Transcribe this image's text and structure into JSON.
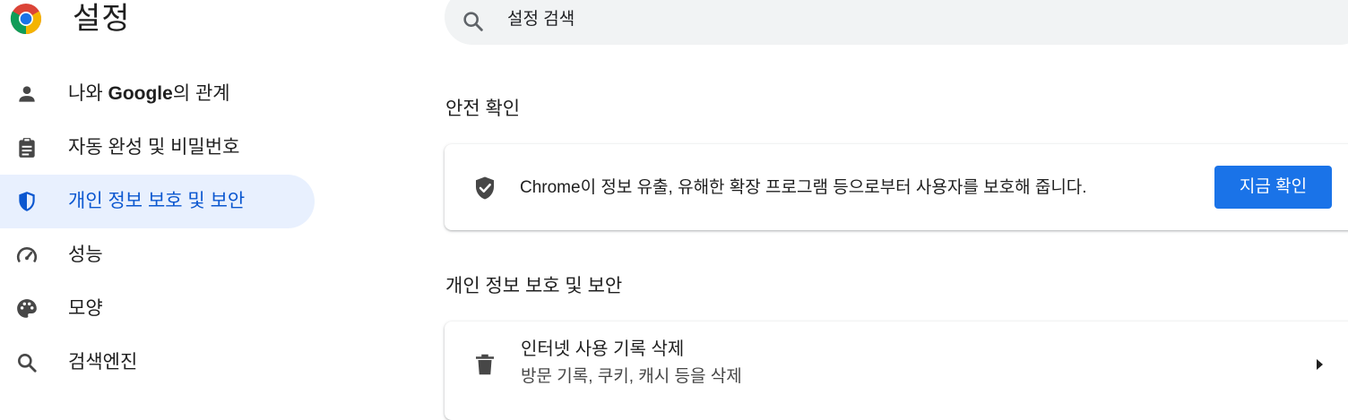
{
  "header": {
    "title": "설정",
    "search_placeholder": "설정 검색"
  },
  "sidebar": {
    "items": [
      {
        "label_prefix": "나와 ",
        "label_brand": "Google",
        "label_suffix": "의 관계",
        "icon": "person-icon"
      },
      {
        "label": "자동 완성 및 비밀번호",
        "icon": "clipboard-icon"
      },
      {
        "label": "개인 정보 보호 및 보안",
        "icon": "shield-icon",
        "active": true
      },
      {
        "label": "성능",
        "icon": "speedometer-icon"
      },
      {
        "label": "모양",
        "icon": "palette-icon"
      },
      {
        "label": "검색엔진",
        "icon": "search-icon"
      }
    ]
  },
  "main": {
    "safety_check": {
      "title": "안전 확인",
      "text": "Chrome이 정보 유출, 유해한 확장 프로그램 등으로부터 사용자를 보호해 줍니다.",
      "button": "지금 확인"
    },
    "privacy": {
      "title": "개인 정보 보호 및 보안",
      "rows": [
        {
          "title": "인터넷 사용 기록 삭제",
          "subtitle": "방문 기록, 쿠키, 캐시 등을 삭제",
          "icon": "trash-icon"
        }
      ]
    }
  },
  "colors": {
    "accent": "#1a73e8",
    "active_bg": "#e8f0fe",
    "active_text": "#0b57d0",
    "search_bg": "#f1f3f4"
  }
}
